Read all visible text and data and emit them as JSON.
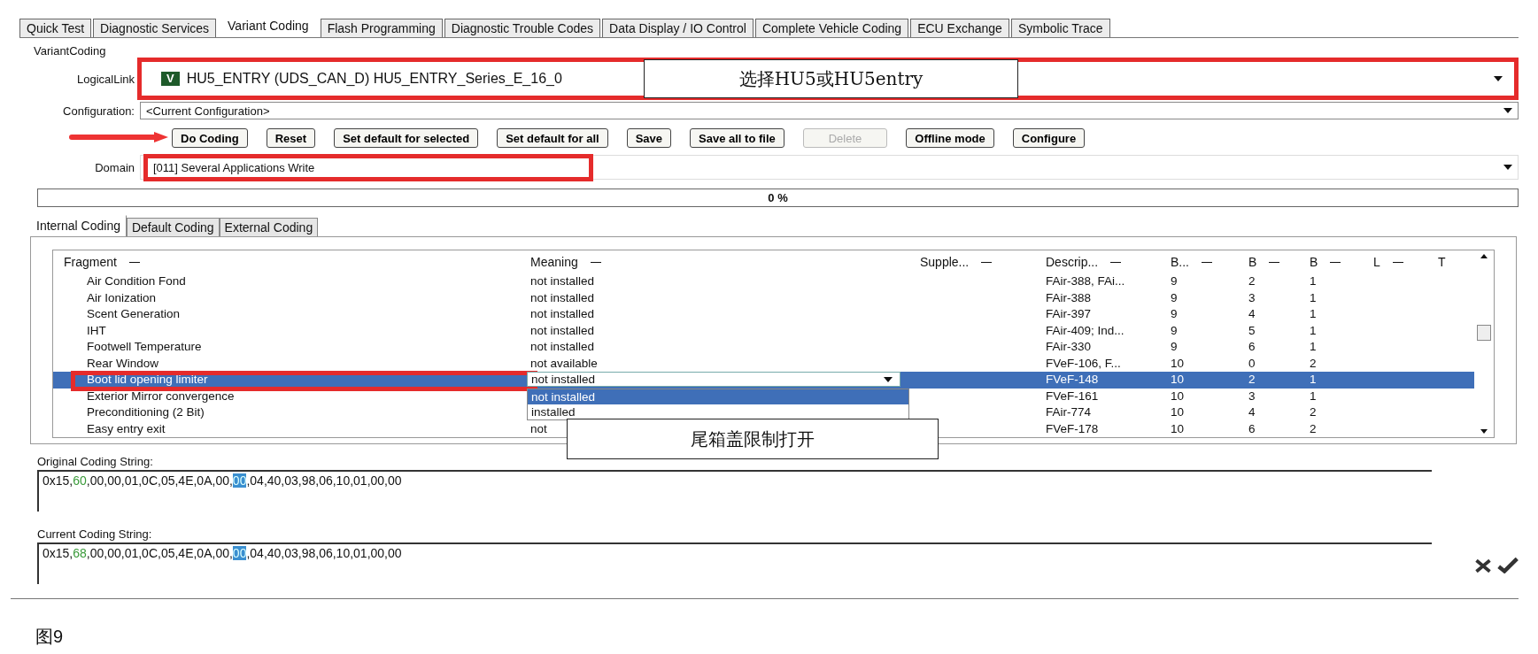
{
  "tabs": [
    {
      "label": "Quick Test",
      "selected": false
    },
    {
      "label": "Diagnostic Services",
      "selected": false
    },
    {
      "label": "Variant Coding",
      "selected": true
    },
    {
      "label": "Flash Programming",
      "selected": false
    },
    {
      "label": "Diagnostic Trouble Codes",
      "selected": false
    },
    {
      "label": "Data Display / IO Control",
      "selected": false
    },
    {
      "label": "Complete Vehicle Coding",
      "selected": false
    },
    {
      "label": "ECU Exchange",
      "selected": false
    },
    {
      "label": "Symbolic Trace",
      "selected": false
    }
  ],
  "group_title": "VariantCoding",
  "logical_link": {
    "label": "LogicalLink",
    "badge": "V",
    "value": "HU5_ENTRY (UDS_CAN_D) HU5_ENTRY_Series_E_16_0"
  },
  "configuration": {
    "label": "Configuration:",
    "value": "<Current Configuration>"
  },
  "buttons": [
    {
      "label": "Do Coding",
      "disabled": false
    },
    {
      "label": "Reset",
      "disabled": false
    },
    {
      "label": "Set default for selected",
      "disabled": false
    },
    {
      "label": "Set default for all",
      "disabled": false
    },
    {
      "label": "Save",
      "disabled": false
    },
    {
      "label": "Save all to file",
      "disabled": false
    },
    {
      "label": "Delete",
      "disabled": true
    },
    {
      "label": "Offline mode",
      "disabled": false
    },
    {
      "label": "Configure",
      "disabled": false
    }
  ],
  "domain": {
    "label": "Domain",
    "value": "[011] Several Applications Write"
  },
  "progress": {
    "level": 0,
    "reading": "0 %"
  },
  "inner_tabs": [
    {
      "label": "Internal Coding",
      "selected": true
    },
    {
      "label": "Default Coding",
      "selected": false
    },
    {
      "label": "External Coding",
      "selected": false
    }
  ],
  "table": {
    "columns": [
      "Fragment",
      "Meaning",
      "Supple...",
      "Descrip...",
      "B...",
      "B",
      "B",
      "L",
      "T"
    ],
    "rows": [
      {
        "fragment": "Air Condition Fond",
        "meaning": "not installed",
        "description": "FAir-388, FAi...",
        "b1": "9",
        "b2": "2",
        "b3": "1",
        "selected": false
      },
      {
        "fragment": "Air Ionization",
        "meaning": "not installed",
        "description": "FAir-388",
        "b1": "9",
        "b2": "3",
        "b3": "1",
        "selected": false
      },
      {
        "fragment": "Scent Generation",
        "meaning": "not installed",
        "description": "FAir-397",
        "b1": "9",
        "b2": "4",
        "b3": "1",
        "selected": false
      },
      {
        "fragment": "IHT",
        "meaning": "not installed",
        "description": "FAir-409; Ind...",
        "b1": "9",
        "b2": "5",
        "b3": "1",
        "selected": false
      },
      {
        "fragment": "Footwell Temperature",
        "meaning": "not installed",
        "description": "FAir-330",
        "b1": "9",
        "b2": "6",
        "b3": "1",
        "selected": false
      },
      {
        "fragment": "Rear Window",
        "meaning": "not available",
        "description": "FVeF-106, F...",
        "b1": "10",
        "b2": "0",
        "b3": "2",
        "selected": false
      },
      {
        "fragment": "Boot lid opening limiter",
        "editor": {
          "value": "not installed",
          "options": [
            {
              "label": "not installed",
              "selected": true
            },
            {
              "label": "installed",
              "selected": false
            }
          ]
        },
        "description": "FVeF-148",
        "b1": "10",
        "b2": "2",
        "b3": "1",
        "selected": true
      },
      {
        "fragment": "Exterior Mirror convergence",
        "description": "FVeF-161",
        "b1": "10",
        "b2": "3",
        "b3": "1",
        "selected": false
      },
      {
        "fragment": "Preconditioning (2 Bit)",
        "description": "FAir-774",
        "b1": "10",
        "b2": "4",
        "b3": "2",
        "selected": false
      },
      {
        "fragment": "Easy entry exit",
        "meaning": "not",
        "description": "FVeF-178",
        "b1": "10",
        "b2": "6",
        "b3": "2",
        "selected": false
      }
    ]
  },
  "callouts": [
    {
      "text": "选择HU5或HU5entry"
    },
    {
      "text": "尾箱盖限制打开"
    }
  ],
  "coding_strings": [
    {
      "label": "Original Coding String:",
      "segments": [
        {
          "text": "0x15,",
          "kind": "plain"
        },
        {
          "text": "60",
          "kind": "changed"
        },
        {
          "text": ",00,00,01,0C,05,4E,0A,00,",
          "kind": "plain"
        },
        {
          "text": "00",
          "kind": "marked"
        },
        {
          "text": ",04,40,03,98,06,10,01,00,00",
          "kind": "plain"
        }
      ]
    },
    {
      "label": "Current Coding String:",
      "segments": [
        {
          "text": "0x15,",
          "kind": "plain"
        },
        {
          "text": "68",
          "kind": "changed"
        },
        {
          "text": ",00,00,01,0C,05,4E,0A,00,",
          "kind": "plain"
        },
        {
          "text": "00",
          "kind": "marked"
        },
        {
          "text": ",04,40,03,98,06,10,01,00,00",
          "kind": "plain"
        }
      ]
    }
  ],
  "caption": "图9"
}
